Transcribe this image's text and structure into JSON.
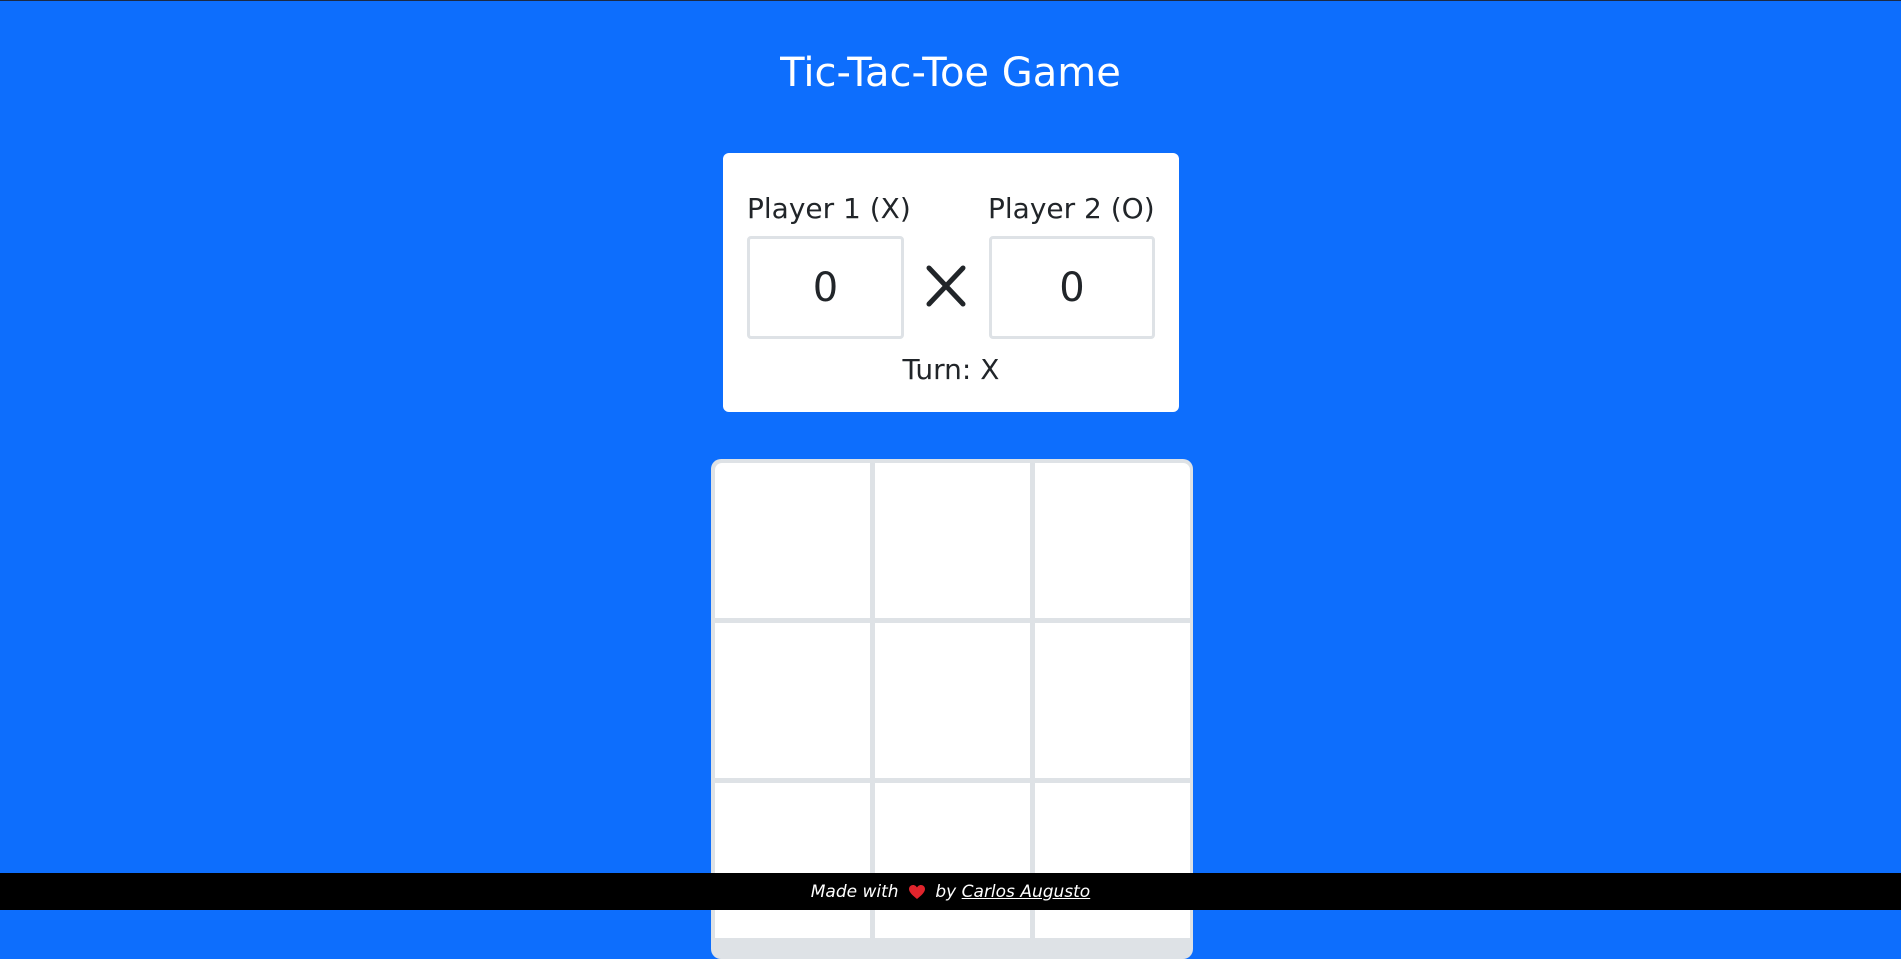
{
  "title": "Tic-Tac-Toe Game",
  "scoreboard": {
    "player1_label": "Player 1 (X)",
    "player2_label": "Player 2 (O)",
    "player1_score": "0",
    "player2_score": "0",
    "versus_icon": "x-icon",
    "turn_text": "Turn: X"
  },
  "board": {
    "cells": [
      "",
      "",
      "",
      "",
      "",
      "",
      "",
      "",
      ""
    ]
  },
  "footer": {
    "made_with": "Made with ",
    "heart_icon": "heart-icon",
    "by": " by ",
    "author": "Carlos Augusto"
  },
  "colors": {
    "background": "#0d6efd",
    "card": "#ffffff",
    "cell_border": "#dee2e6",
    "footer": "#000000",
    "heart": "#e0242c"
  }
}
